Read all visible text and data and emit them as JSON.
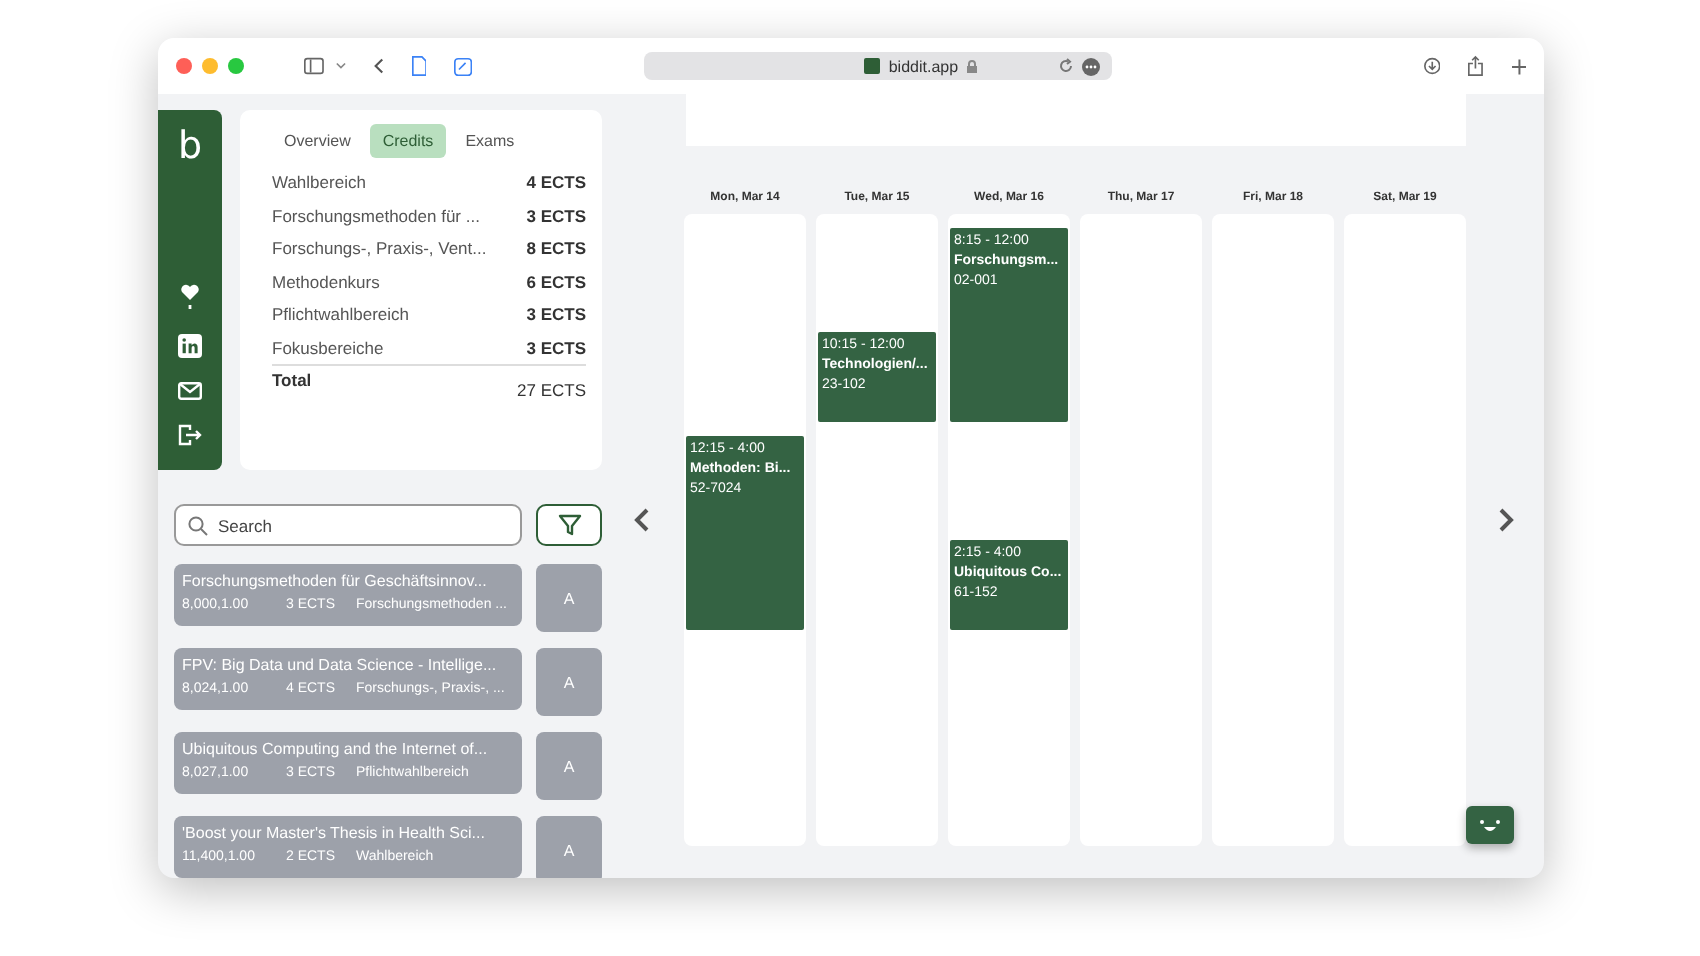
{
  "browser": {
    "address": "biddit.app"
  },
  "sidebar": {
    "logo": "b"
  },
  "credits_card": {
    "tabs": [
      {
        "label": "Overview",
        "selected": false
      },
      {
        "label": "Credits",
        "selected": true
      },
      {
        "label": "Exams",
        "selected": false
      }
    ],
    "rows": [
      {
        "name": "Wahlbereich",
        "credits": "4 ECTS"
      },
      {
        "name": "Forschungsmethoden für ...",
        "credits": "3 ECTS"
      },
      {
        "name": "Forschungs-, Praxis-, Vent...",
        "credits": "8 ECTS"
      },
      {
        "name": "Methodenkurs",
        "credits": "6 ECTS"
      },
      {
        "name": "Pflichtwahlbereich",
        "credits": "3 ECTS"
      },
      {
        "name": "Fokusbereiche",
        "credits": "3 ECTS"
      }
    ],
    "total": {
      "label": "Total",
      "credits": "27 ECTS"
    }
  },
  "search": {
    "placeholder": "Search"
  },
  "courses": [
    {
      "title": "Forschungsmethoden für Geschäftsinnov...",
      "number": "8,000,1.00",
      "credits": "3 ECTS",
      "area": "Forschungsmethoden ...",
      "action": "A"
    },
    {
      "title": "FPV: Big Data und Data Science - Intellige...",
      "number": "8,024,1.00",
      "credits": "4 ECTS",
      "area": "Forschungs-, Praxis-, ...",
      "action": "A"
    },
    {
      "title": "Ubiquitous Computing and the Internet of...",
      "number": "8,027,1.00",
      "credits": "3 ECTS",
      "area": "Pflichtwahlbereich",
      "action": "A"
    },
    {
      "title": "'Boost your Master's Thesis in Health Sci...",
      "number": "11,400,1.00",
      "credits": "2 ECTS",
      "area": "Wahlbereich",
      "action": "A"
    }
  ],
  "calendar": {
    "days": [
      {
        "label": "Mon, Mar 14",
        "events": [
          {
            "time": "12:15 - 4:00",
            "title": "Methoden: Bi...",
            "room": "52-7024"
          }
        ]
      },
      {
        "label": "Tue, Mar 15",
        "events": [
          {
            "time": "10:15 - 12:00",
            "title": "Technologien/...",
            "room": "23-102"
          }
        ]
      },
      {
        "label": "Wed, Mar 16",
        "events": [
          {
            "time": "8:15 - 12:00",
            "title": "Forschungsm...",
            "room": "02-001"
          },
          {
            "time": "2:15 - 4:00",
            "title": "Ubiquitous Co...",
            "room": "61-152"
          }
        ]
      },
      {
        "label": "Thu, Mar 17"
      },
      {
        "label": "Fri, Mar 18"
      },
      {
        "label": "Sat, Mar 19"
      }
    ]
  }
}
